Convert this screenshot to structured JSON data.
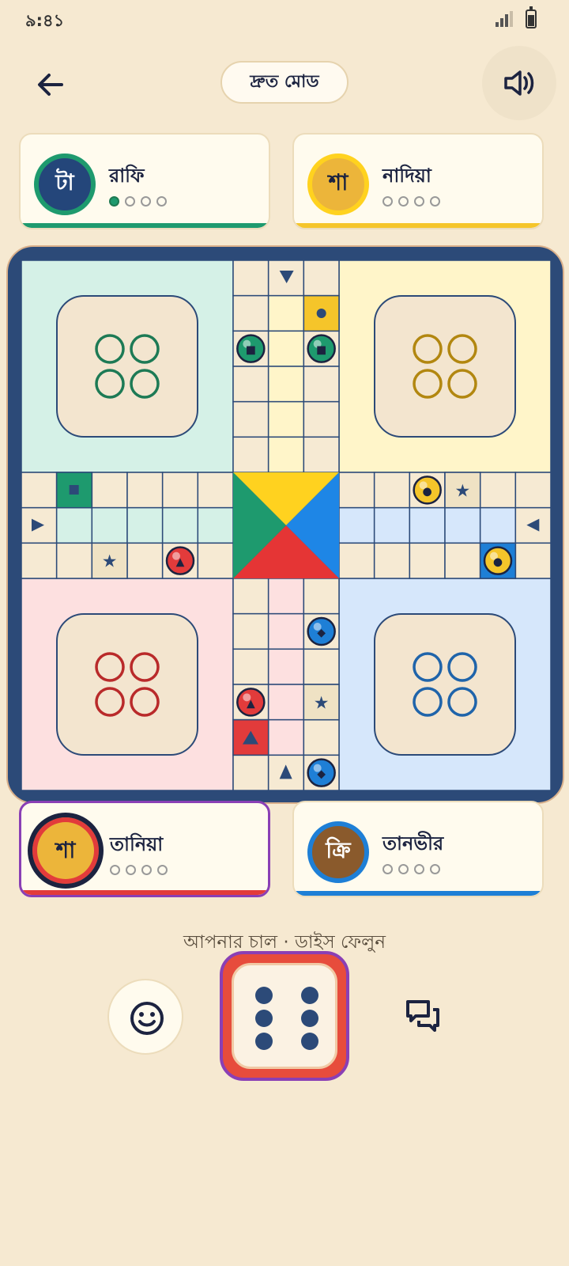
{
  "status_bar": {
    "time": "৯:৪১",
    "signal_icon": "signal-icon",
    "battery_icon": "battery-icon"
  },
  "header": {
    "back_icon": "back-arrow-icon",
    "mode_label": "দ্রুত মোড",
    "sound_icon": "speaker-icon"
  },
  "players": {
    "top_left": {
      "name": "রাফি",
      "avatar_text": "টা",
      "color": "#1e9a6e",
      "progress": [
        true,
        false,
        false,
        false
      ]
    },
    "top_right": {
      "name": "নাদিয়া",
      "avatar_text": "শা",
      "color": "#f5c52a",
      "progress": [
        false,
        false,
        false,
        false
      ]
    },
    "bottom_left": {
      "name": "তানিয়া",
      "avatar_text": "শা",
      "color": "#e23b3b",
      "progress": [
        false,
        false,
        false,
        false
      ],
      "active": true
    },
    "bottom_right": {
      "name": "তানভীর",
      "avatar_text": "ক্রি",
      "color": "#1e7fd6",
      "progress": [
        false,
        false,
        false,
        false
      ]
    }
  },
  "board": {
    "colors": {
      "green": "#1e9a6e",
      "yellow": "#f5c52a",
      "red": "#e23b3b",
      "blue": "#1e7fd6"
    },
    "tokens": [
      {
        "color": "green",
        "cell": [
          6,
          2
        ]
      },
      {
        "color": "green",
        "cell": [
          8,
          2
        ]
      },
      {
        "color": "yellow",
        "cell": [
          11,
          6
        ]
      },
      {
        "color": "yellow",
        "cell": [
          13,
          8
        ]
      },
      {
        "color": "red",
        "cell": [
          4,
          8
        ]
      },
      {
        "color": "red",
        "cell": [
          6,
          12
        ]
      },
      {
        "color": "blue",
        "cell": [
          8,
          10
        ]
      },
      {
        "color": "blue",
        "cell": [
          8,
          14
        ]
      }
    ]
  },
  "turn_message": "আপনার চাল · ডাইস ফেলুন",
  "dice_value": 6,
  "controls": {
    "emoji_icon": "smiley-icon",
    "dice_icon": "dice-icon",
    "chat_icon": "chat-icon"
  }
}
